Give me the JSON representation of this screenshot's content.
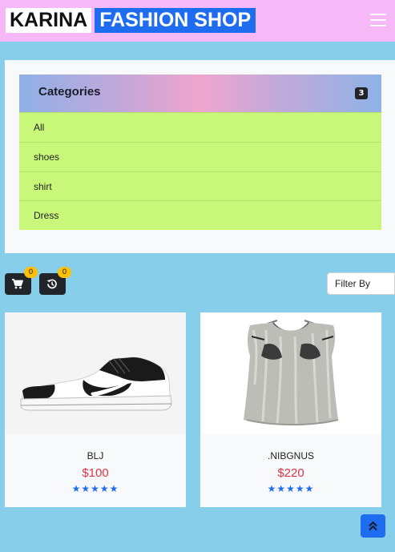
{
  "brand": {
    "part1": "KARINA",
    "part2": "FASHION SHOP"
  },
  "navbar": {
    "menu_icon": "hamburger-icon"
  },
  "categories": {
    "title": "Categories",
    "count": "3",
    "items": [
      "All",
      "shoes",
      "shirt",
      "Dress"
    ]
  },
  "toolbar": {
    "cart_icon": "cart-icon",
    "cart_count": "0",
    "history_icon": "history-icon",
    "history_count": "0",
    "filter_label": "Filter By"
  },
  "products": [
    {
      "name": "BLJ",
      "price": "$100",
      "stars": "★★★★★",
      "rating": 5,
      "image": "sneaker-image"
    },
    {
      "name": ".NIBGNUS",
      "price": "$220",
      "stars": "★★★★★",
      "rating": 5,
      "image": "knit-top-image"
    }
  ],
  "scroll_top_icon": "double-chevron-up-icon",
  "colors": {
    "accent": "#1e6cf0",
    "navbar": "#f7b8f7",
    "category_item": "#c9f77a",
    "price": "#dc3545",
    "page_bg": "#87ceeb",
    "badge": "#ffc107"
  }
}
